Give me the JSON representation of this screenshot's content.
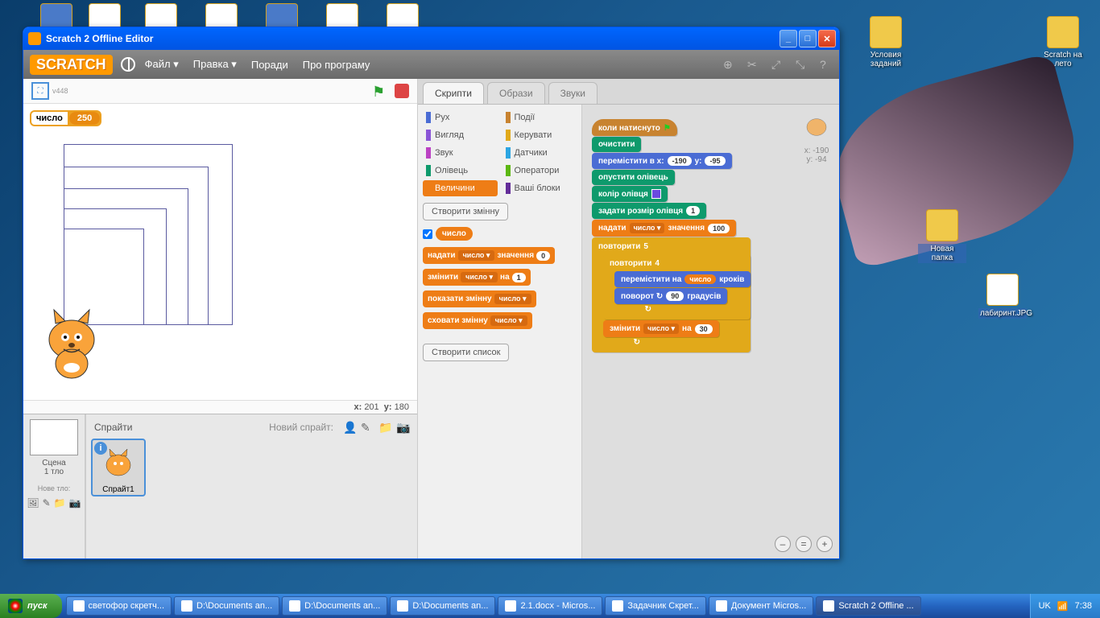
{
  "window": {
    "title": "Scratch 2 Offline Editor",
    "logo": "SCRATCH",
    "version": "v448",
    "menu": {
      "file": "Файл ▾",
      "edit": "Правка ▾",
      "tips": "Поради",
      "about": "Про програму"
    }
  },
  "stage": {
    "var_name": "число",
    "var_value": "250",
    "coords_x_label": "x:",
    "coords_x": "201",
    "coords_y_label": "y:",
    "coords_y": "180"
  },
  "sprite_panel": {
    "sprites_label": "Спрайти",
    "new_sprite_label": "Новий спрайт:",
    "stage_label": "Сцена",
    "backdrop_label": "1 тло",
    "new_backdrop_label": "Нове тло:",
    "sprite1": "Спрайт1"
  },
  "tabs": {
    "scripts": "Скрипти",
    "costumes": "Образи",
    "sounds": "Звуки"
  },
  "categories": {
    "motion": "Рух",
    "looks": "Вигляд",
    "sound": "Звук",
    "pen": "Олівець",
    "data": "Величини",
    "events": "Події",
    "control": "Керувати",
    "sensing": "Датчики",
    "operators": "Оператори",
    "more": "Ваші блоки"
  },
  "palette": {
    "make_var": "Створити змінну",
    "var_pill": "число",
    "set_a": "надати",
    "set_b": "значення",
    "set_v": "0",
    "change_a": "змінити",
    "change_b": "на",
    "change_v": "1",
    "show_a": "показати змінну",
    "hide_a": "сховати змінну",
    "make_list": "Створити список"
  },
  "script": {
    "when_flag": "коли натиснуто",
    "clear": "очистити",
    "goto_a": "перемістити в x:",
    "goto_x": "-190",
    "goto_b": "y:",
    "goto_y": "-95",
    "pendown": "опустити олівець",
    "pencolor": "колір олівця",
    "pensize_a": "задати розмір олівця",
    "pensize_v": "1",
    "set_a": "надати",
    "set_var": "число ▾",
    "set_b": "значення",
    "set_v": "100",
    "repeat1_a": "повторити",
    "repeat1_v": "5",
    "repeat2_a": "повторити",
    "repeat2_v": "4",
    "move_a": "перемістити на",
    "move_var": "число",
    "move_b": "кроків",
    "turn_a": "поворот ↻",
    "turn_v": "90",
    "turn_b": "градусів",
    "change_a": "змінити",
    "change_var": "число ▾",
    "change_b": "на",
    "change_v": "30"
  },
  "sprite_info": {
    "x_lbl": "x:",
    "x": "-190",
    "y_lbl": "y:",
    "y": "-94"
  },
  "desktop_icons": {
    "cond": "Условия заданий",
    "summer": "Scratch на лето",
    "folder": "Новая папка",
    "lab": "лабиринт.JPG"
  },
  "taskbar": {
    "start": "пуск",
    "items": [
      "светофор скретч...",
      "D:\\Documents an...",
      "D:\\Documents an...",
      "D:\\Documents an...",
      "2.1.docx - Micros...",
      "Задачник Скрет...",
      "Документ Micros...",
      "Scratch 2 Offline ..."
    ],
    "lang": "UK",
    "time": "7:38"
  },
  "colors": {
    "motion": "#4a6cd4",
    "looks": "#8a55d7",
    "sound": "#bb42c3",
    "pen": "#0e9a6c",
    "data": "#ee7d16",
    "events": "#c88330",
    "control": "#e1a91a",
    "sensing": "#2ca5e2",
    "operators": "#5cb712",
    "more": "#632d99"
  }
}
